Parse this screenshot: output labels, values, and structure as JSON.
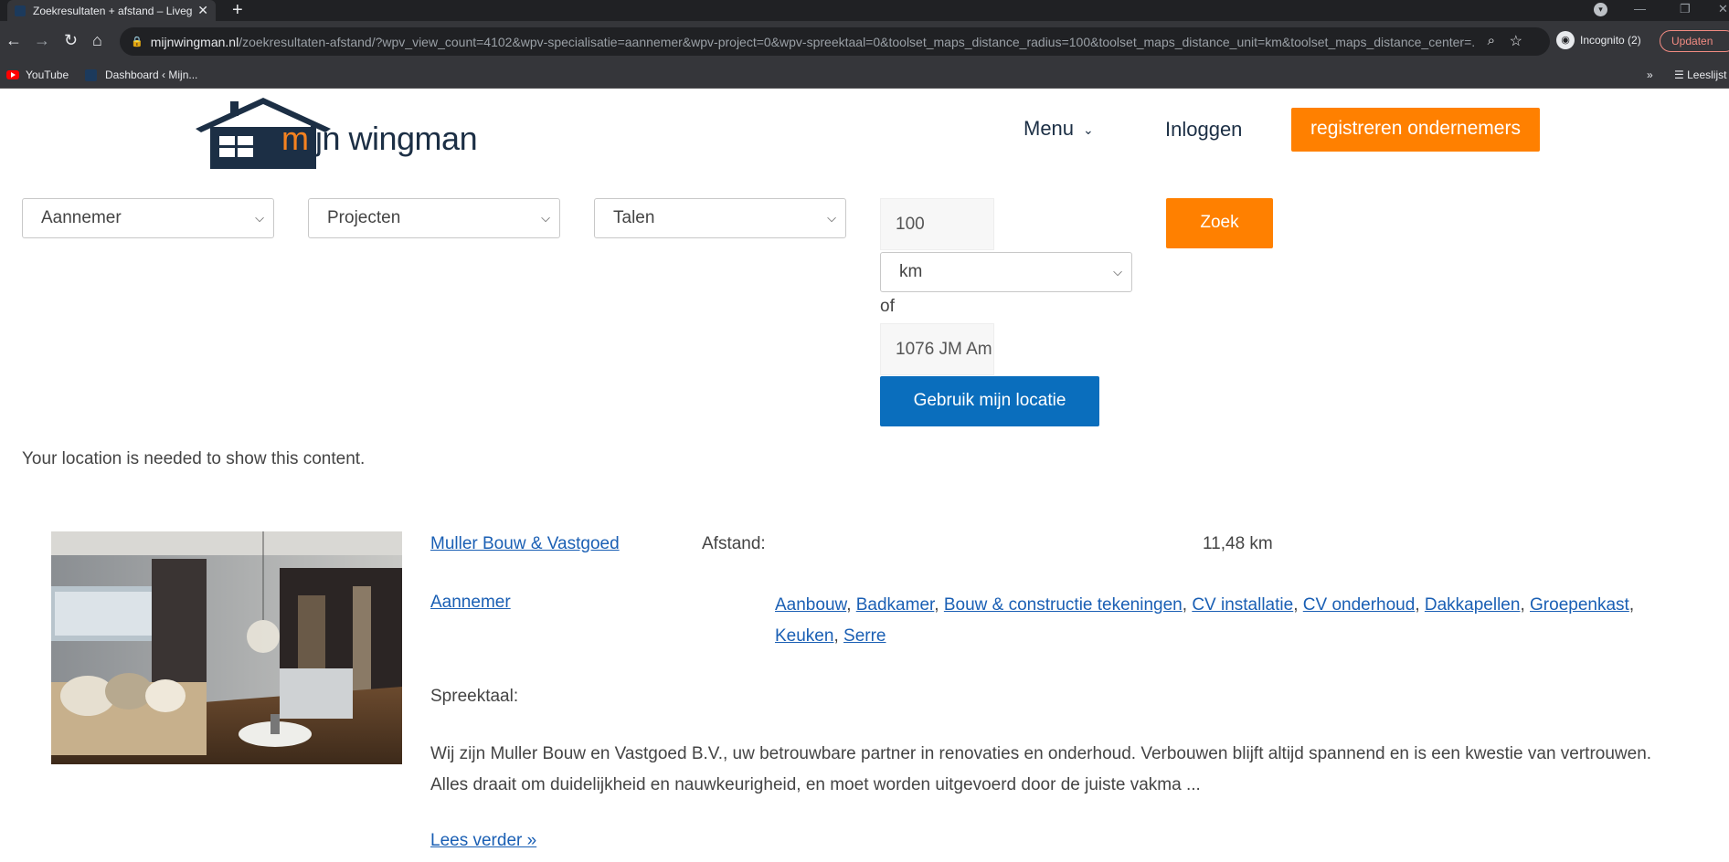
{
  "browser": {
    "tab_title": "Zoekresultaten + afstand – Liveg",
    "tab_close": "✕",
    "new_tab": "+",
    "url_host": "mijnwingman.nl",
    "url_path": "/zoekresultaten-afstand/?wpv_view_count=4102&wpv-specialisatie=aannemer&wpv-project=0&wpv-spreektaal=0&toolset_maps_distance_radius=100&toolset_maps_distance_unit=km&toolset_maps_distance_center=...",
    "incognito_label": "Incognito (2)",
    "update_label": "Updaten",
    "bookmarks": [
      {
        "label": "YouTube"
      },
      {
        "label": "Dashboard ‹ Mijn..."
      }
    ],
    "reading_list": "Leeslijst"
  },
  "header": {
    "logo_text_accent": "m",
    "logo_text_rest": "ijn wingman",
    "menu_label": "Menu",
    "login_label": "Inloggen",
    "register_label": "registreren ondernemers"
  },
  "filters": {
    "specialisatie": "Aannemer",
    "projecten": "Projecten",
    "talen": "Talen",
    "radius": "100",
    "unit": "km",
    "or_label": "of",
    "location": "1076 JM Am",
    "search_label": "Zoek",
    "use_location_label": "Gebruik mijn locatie"
  },
  "notice": "Your location is needed to show this content.",
  "result": {
    "name": "Muller Bouw & Vastgoed",
    "distance_label": "Afstand:",
    "distance_value": "11,48 km",
    "category": "Aannemer",
    "tags": [
      "Aanbouw",
      "Badkamer",
      "Bouw & constructie tekeningen",
      "CV installatie",
      "CV onderhoud",
      "Dakkapellen",
      "Groepenkast",
      "Keuken",
      "Serre"
    ],
    "language_label": "Spreektaal:",
    "description": "Wij zijn Muller Bouw en Vastgoed B.V., uw betrouwbare partner in renovaties en onderhoud. Verbouwen blijft altijd spannend en is een kwestie van vertrouwen. Alles draait om duidelijkheid en nauwkeurigheid, en moet worden uitgevoerd door de juiste vakma ...",
    "read_more": "Lees verder »"
  },
  "colors": {
    "brand_orange": "#ff8000",
    "brand_navy": "#1c2f45",
    "button_blue": "#0a6ebd",
    "link_blue": "#1a5fb4"
  }
}
